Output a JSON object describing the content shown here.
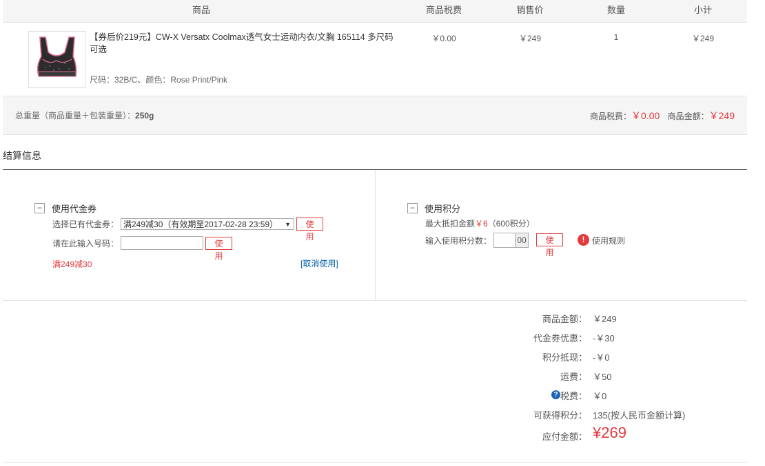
{
  "table_header": {
    "product": "商品",
    "tax": "商品税费",
    "price": "销售价",
    "qty": "数量",
    "subtotal": "小计"
  },
  "product": {
    "title": "【券后价219元】CW-X Versatx Coolmax透气女士运动内衣/文胸 165114 多尺码可选",
    "attrs": "尺码：32B/C、颜色：Rose Print/Pink",
    "tax": "￥0.00",
    "price": "￥249",
    "qty": "1",
    "subtotal": "￥249"
  },
  "summary": {
    "weight_label": "总重量（商品重量＋包装重量）：",
    "weight_value": "250g",
    "tax_label": "商品税费：",
    "tax_value": "￥0.00",
    "amount_label": "商品金额：",
    "amount_value": "￥249"
  },
  "settlement": {
    "title": "结算信息",
    "coupon": {
      "toggle": "−",
      "heading": "使用代金券",
      "select_label": "选择已有代金券：",
      "select_value": "满249减30（有效期至2017-02-28 23:59）",
      "use_label": "使用",
      "code_label": "请在此输入号码：",
      "code_value": "",
      "applied": "满249减30",
      "cancel": "[取消使用]"
    },
    "points": {
      "toggle": "−",
      "heading": "使用积分",
      "max_label": "最大抵扣金额",
      "max_value": "￥6",
      "max_points": "（600积分）",
      "input_label": "输入使用积分数：",
      "input_value": "",
      "input_suffix": "00",
      "use_label": "使用",
      "rules": "使用规则"
    }
  },
  "totals": {
    "goods_label": "商品金额：",
    "goods_value": "￥249",
    "coupon_label": "代金券优惠：",
    "coupon_value": "-￥30",
    "points_label": "积分抵现：",
    "points_value": "-￥0",
    "shipping_label": "运费：",
    "shipping_value": "￥50",
    "tax_label": "税费：",
    "tax_value": "￥0",
    "earn_label": "可获得积分：",
    "earn_value": "135(按人民币金额计算)",
    "pay_label": "应付金额：",
    "pay_value": "¥269"
  },
  "colors": {
    "accent": "#e4393c",
    "link": "#005ea7",
    "info": "#1a66b3"
  }
}
